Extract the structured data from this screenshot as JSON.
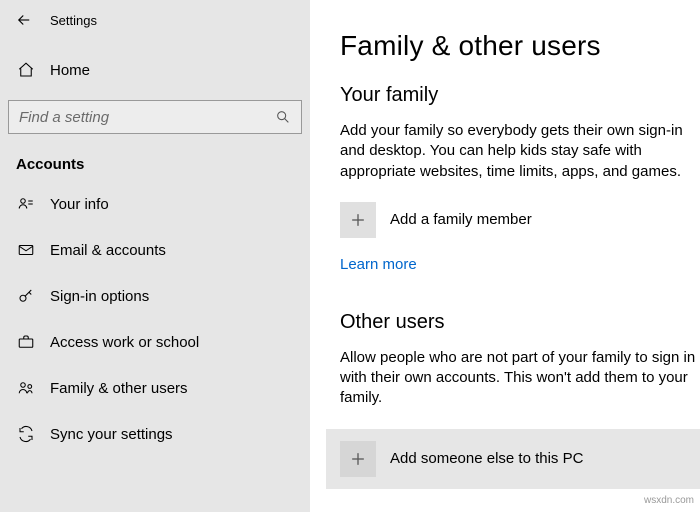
{
  "window": {
    "title": "Settings"
  },
  "home_label": "Home",
  "search": {
    "placeholder": "Find a setting"
  },
  "nav_section": "Accounts",
  "nav": {
    "your_info": "Your info",
    "email": "Email & accounts",
    "signin": "Sign-in options",
    "work": "Access work or school",
    "family": "Family & other users",
    "sync": "Sync your settings"
  },
  "page": {
    "title": "Family & other users",
    "family_heading": "Your family",
    "family_body": "Add your family so everybody gets their own sign-in and desktop. You can help kids stay safe with appropriate websites, time limits, apps, and games.",
    "add_family": "Add a family member",
    "learn_more": "Learn more",
    "other_heading": "Other users",
    "other_body": "Allow people who are not part of your family to sign in with their own accounts. This won't add them to your family.",
    "add_other": "Add someone else to this PC"
  },
  "watermark": "wsxdn.com"
}
